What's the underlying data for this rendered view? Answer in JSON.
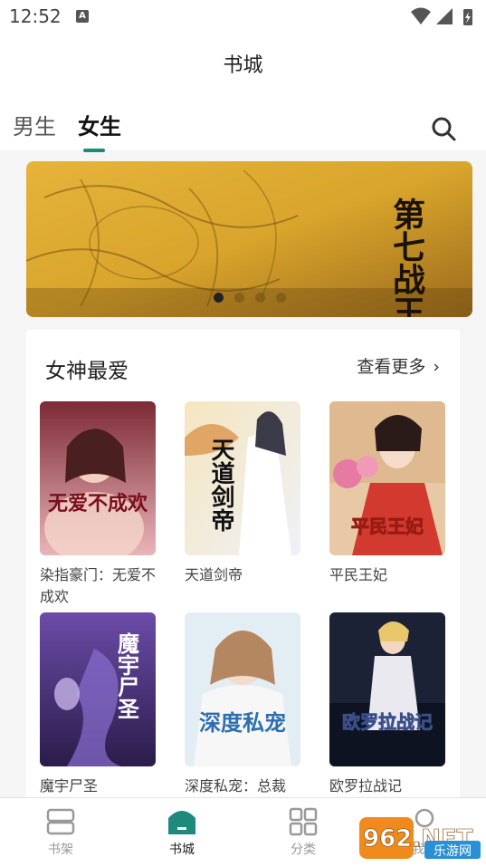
{
  "status": {
    "time": "12:52",
    "notification_badge": "A"
  },
  "header": {
    "title": "书城"
  },
  "tabs": [
    {
      "label": "男生",
      "active": false
    },
    {
      "label": "女生",
      "active": true
    }
  ],
  "banner": {
    "slide_count": 4,
    "active_index": 0,
    "art_text": "第七战王"
  },
  "section": {
    "title": "女神最爱",
    "more_label": "查看更多",
    "books": [
      {
        "title": "染指豪门：无爱不成欢",
        "cover_text": "无爱不成欢"
      },
      {
        "title": "天道剑帝",
        "cover_text": "天道剑帝"
      },
      {
        "title": "平民王妃",
        "cover_text": "平民王妃"
      },
      {
        "title": "魔宇尸圣",
        "cover_text": "魔宇尸圣"
      },
      {
        "title": "深度私宠：总裁",
        "cover_text": "深度私宠"
      },
      {
        "title": "欧罗拉战记",
        "cover_text": "欧罗拉战记"
      }
    ]
  },
  "bottom_nav": [
    {
      "label": "书架",
      "icon": "bookshelf-icon",
      "active": false
    },
    {
      "label": "书城",
      "icon": "bookstore-icon",
      "active": true
    },
    {
      "label": "分类",
      "icon": "category-grid-icon",
      "active": false
    },
    {
      "label": "我的",
      "icon": "profile-icon",
      "active": false
    }
  ],
  "watermark": {
    "text": "962.NET",
    "subtext": "乐游网"
  },
  "colors": {
    "accent": "#1e8a7c",
    "banner_gold": "#d8a42a"
  }
}
